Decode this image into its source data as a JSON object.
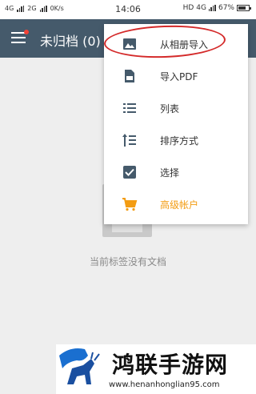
{
  "status_bar": {
    "network_left": "4G",
    "network_right": "2G",
    "speed": "0K/s",
    "time": "14:06",
    "hd_label": "HD",
    "net_label": "4G",
    "battery_pct": "67%"
  },
  "app_bar": {
    "title": "未归档 (0)"
  },
  "empty_state": {
    "message": "当前标签没有文档"
  },
  "menu": {
    "items": [
      {
        "label": "从相册导入",
        "icon": "image-icon"
      },
      {
        "label": "导入PDF",
        "icon": "pdf-icon"
      },
      {
        "label": "列表",
        "icon": "list-icon"
      },
      {
        "label": "排序方式",
        "icon": "sort-icon"
      },
      {
        "label": "选择",
        "icon": "checkbox-icon"
      },
      {
        "label": "高级帐户",
        "icon": "cart-icon"
      }
    ]
  },
  "watermark": {
    "title": "鸿联手游网",
    "url": "www.henanhonglian95.com"
  },
  "colors": {
    "app_bar": "#455a6b",
    "premium": "#f39c12",
    "highlight": "#d42a2a"
  }
}
